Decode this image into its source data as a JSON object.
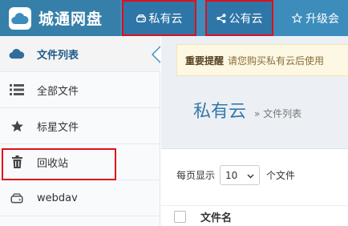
{
  "header": {
    "app_name": "城通网盘",
    "nav": {
      "private": "私有云",
      "public": "公有云",
      "upgrade": "升级会"
    }
  },
  "sidebar": {
    "items": [
      {
        "label": "文件列表",
        "icon": "cloud-icon"
      },
      {
        "label": "全部文件",
        "icon": "list-icon"
      },
      {
        "label": "标星文件",
        "icon": "star-icon"
      },
      {
        "label": "回收站",
        "icon": "trash-icon"
      },
      {
        "label": "webdav",
        "icon": "drive-icon"
      }
    ]
  },
  "main": {
    "alert_label": "重要提醒",
    "alert_text": "请您购买私有云后使用",
    "title": "私有云",
    "breadcrumb": "» 文件列表",
    "per_page_label": "每页显示",
    "per_page_value": "10",
    "per_page_suffix": "个文件",
    "column_filename": "文件名"
  },
  "colors": {
    "header": "#3c8dbc",
    "highlight": "#e0101a",
    "sidebar_active": "#1f5a86"
  }
}
